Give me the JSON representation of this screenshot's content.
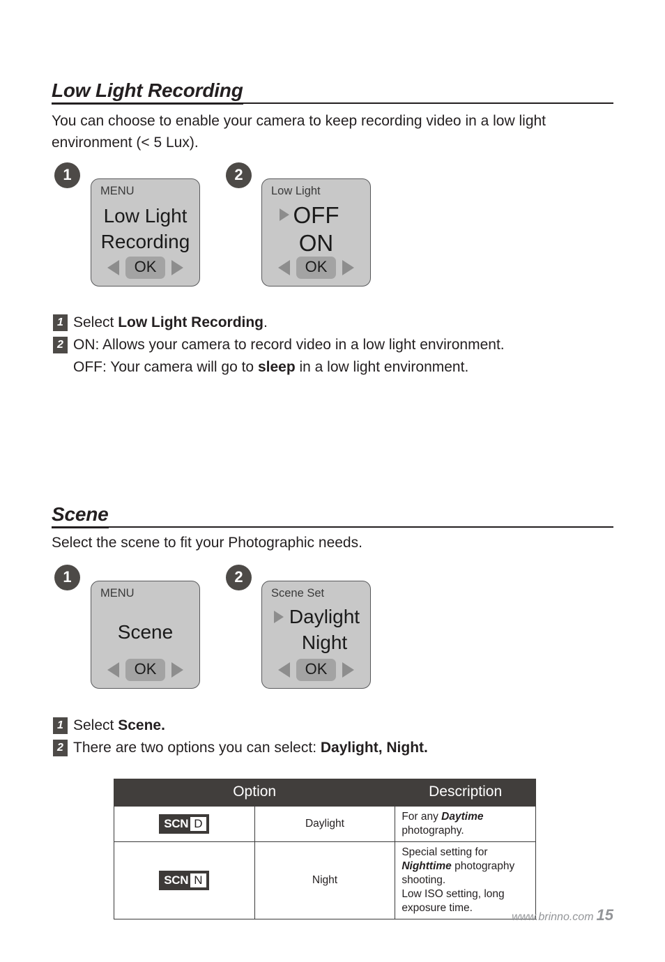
{
  "document": {
    "footer": {
      "website": "www.brinno.com",
      "page_number": "15"
    }
  },
  "sections": [
    {
      "id": "low-light-recording",
      "heading": "Low Light Recording",
      "description": "You can choose to enable your camera to keep recording video in a low light environment (< 5 Lux).",
      "screens": [
        {
          "badge": "1",
          "title": "MENU",
          "lines": [
            {
              "text": "Low Light",
              "selected": false
            },
            {
              "text": "Recording",
              "selected": false
            }
          ],
          "ok_label": "OK",
          "left_arrow": "triangle-left-icon",
          "right_arrow": "triangle-right-icon"
        },
        {
          "badge": "2",
          "title": "Low Light",
          "lines": [
            {
              "text": "OFF",
              "selected": true
            },
            {
              "text": "ON",
              "selected": false
            }
          ],
          "ok_label": "OK",
          "left_arrow": "triangle-left-icon",
          "right_arrow": "triangle-right-icon"
        }
      ],
      "instructions": [
        {
          "number": "1",
          "parts": [
            {
              "text": "Select ",
              "style": "normal"
            },
            {
              "text": "Low Light Recording",
              "style": "bold"
            },
            {
              "text": ".",
              "style": "normal"
            }
          ]
        },
        {
          "number": "2",
          "parts": [
            {
              "text": "ON: Allows your camera to record video in a low light environment.",
              "style": "normal"
            }
          ],
          "second_line": [
            {
              "text": "OFF: Your camera will go to ",
              "style": "normal"
            },
            {
              "text": "sleep",
              "style": "bold"
            },
            {
              "text": " in a low light environment.",
              "style": "normal"
            }
          ]
        }
      ]
    },
    {
      "id": "scene",
      "heading": "Scene",
      "description": "Select the scene to fit your Photographic needs.",
      "screens": [
        {
          "badge": "1",
          "title": "MENU",
          "lines": [
            {
              "text": "Scene",
              "selected": false
            }
          ],
          "ok_label": "OK",
          "left_arrow": "triangle-left-icon",
          "right_arrow": "triangle-right-icon"
        },
        {
          "badge": "2",
          "title": "Scene Set",
          "lines": [
            {
              "text": "Daylight",
              "selected": true
            },
            {
              "text": "Night",
              "selected": false
            }
          ],
          "ok_label": "OK",
          "left_arrow": "triangle-left-icon",
          "right_arrow": "triangle-right-icon"
        }
      ],
      "instructions": [
        {
          "number": "1",
          "parts": [
            {
              "text": "Select ",
              "style": "normal"
            },
            {
              "text": "Scene.",
              "style": "bold"
            }
          ]
        },
        {
          "number": "2",
          "parts": [
            {
              "text": "There are two options you can select: ",
              "style": "normal"
            },
            {
              "text": "Daylight, Night.",
              "style": "bold"
            }
          ]
        }
      ],
      "table": {
        "headers": [
          "Option",
          "Description"
        ],
        "rows": [
          {
            "icon_tag": "SCN",
            "icon_letter": "D",
            "icon_name": "scn-daylight-icon",
            "name": "Daylight",
            "description_parts": [
              {
                "text": "For any ",
                "style": "normal"
              },
              {
                "text": "Daytime",
                "style": "bold-italic"
              },
              {
                "text": " photography.",
                "style": "normal"
              }
            ]
          },
          {
            "icon_tag": "SCN",
            "icon_letter": "N",
            "icon_name": "scn-night-icon",
            "name": "Night",
            "description_parts": [
              {
                "text": "Special setting for ",
                "style": "normal"
              },
              {
                "text": "Nighttime",
                "style": "bold-italic"
              },
              {
                "text": " photography shooting.",
                "style": "normal"
              }
            ],
            "description_line2": [
              {
                "text": "Low ISO setting, long exposure time.",
                "style": "normal"
              }
            ]
          }
        ]
      }
    }
  ],
  "colors": {
    "text": "#231f20",
    "badge": "#4d4a47",
    "lcd_bg": "#c8c8c8",
    "lcd_border": "#58595b",
    "lcd_arrow": "#8d8d8d",
    "ok_button": "#a3a3a3",
    "table_header": "#413e3c",
    "footer_text": "#939598"
  }
}
